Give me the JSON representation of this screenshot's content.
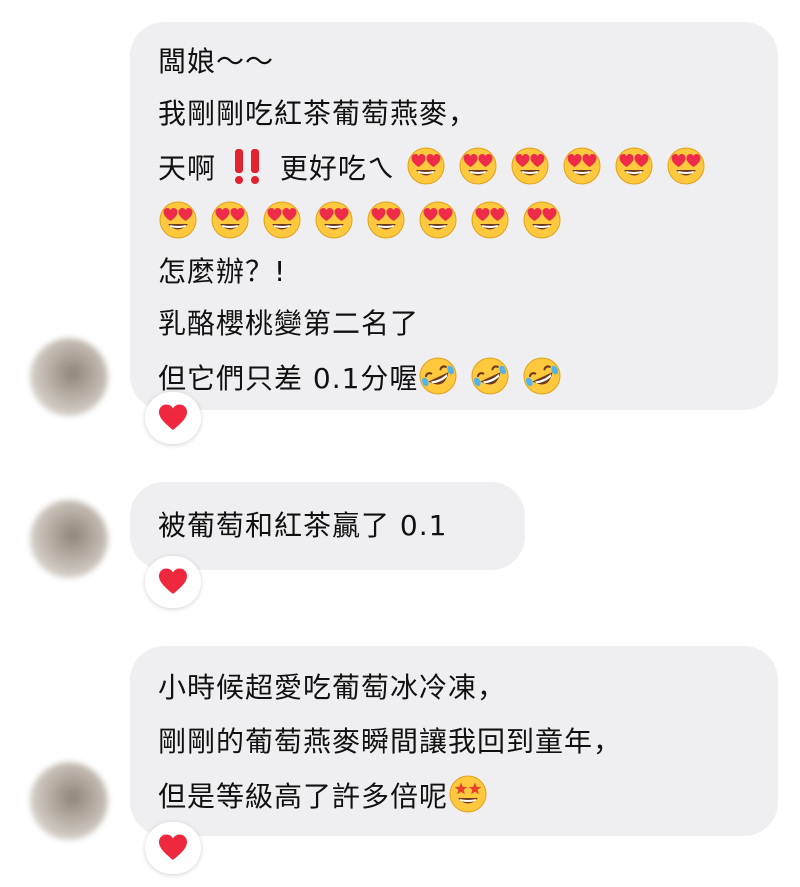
{
  "messages": [
    {
      "lines": {
        "l1": "闆娘～～",
        "l2": "我剛剛吃紅茶葡萄燕麥，",
        "l3_prefix": "天啊",
        "l3_suffix": "更好吃ㄟ",
        "l5": "怎麼辦？!",
        "l6": "乳酪櫻桃變第二名了",
        "l7": "但它們只差 0.1分喔"
      },
      "emoji_rows": {
        "heart_eyes_line3": 6,
        "heart_eyes_line4": 8,
        "rofl_line7": 3
      },
      "reaction": "heart-icon"
    },
    {
      "lines": {
        "l1": "被葡萄和紅茶贏了 0.1"
      },
      "reaction": "heart-icon"
    },
    {
      "lines": {
        "l1": "小時候超愛吃葡萄冰冷凍，",
        "l2": "剛剛的葡萄燕麥瞬間讓我回到童年，",
        "l3": "但是等級高了許多倍呢"
      },
      "emoji_rows": {
        "star_struck_line3": 1
      },
      "reaction": "heart-icon"
    }
  ],
  "colors": {
    "bubble": "#efeff1",
    "heart": "#f0283e",
    "bang": "#e0232f",
    "emoji_face": "#ffc83d"
  }
}
